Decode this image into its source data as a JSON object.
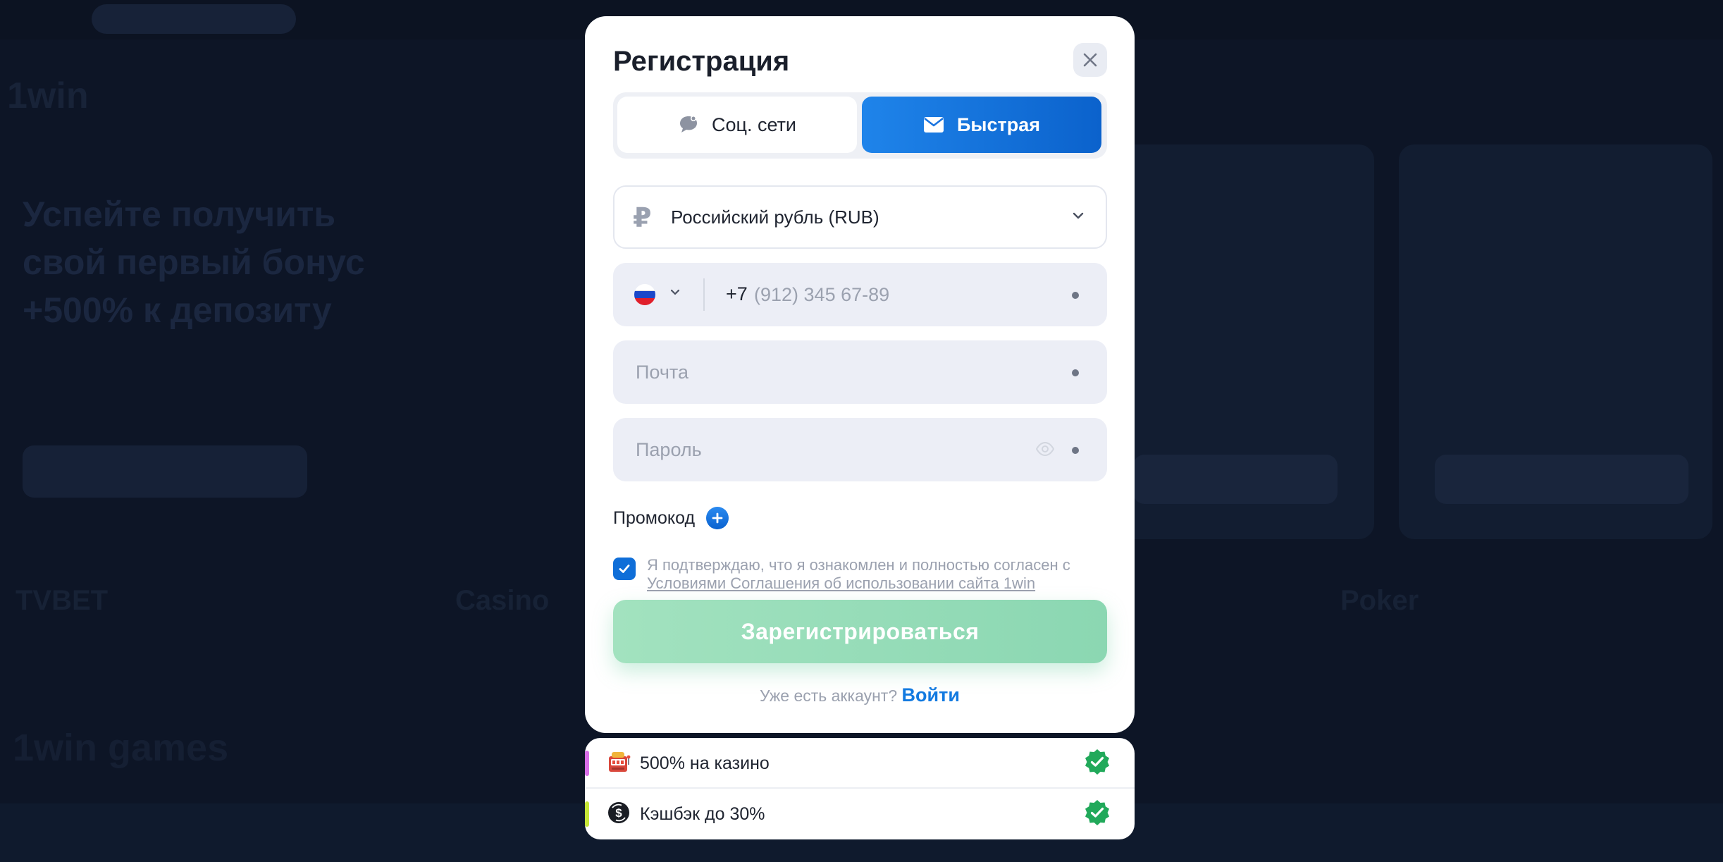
{
  "modal": {
    "title": "Регистрация",
    "tabs": [
      {
        "label": "Соц. сети",
        "icon": "chat-bubble-icon",
        "active": false
      },
      {
        "label": "Быстрая",
        "icon": "envelope-icon",
        "active": true
      }
    ],
    "currency": {
      "symbol": "₽",
      "value": "Российский рубль (RUB)"
    },
    "phone": {
      "country_code": "+7",
      "placeholder": "(912) 345 67-89",
      "flag": "ru"
    },
    "email": {
      "placeholder": "Почта"
    },
    "password": {
      "placeholder": "Пароль"
    },
    "promo_label": "Промокод",
    "agreement": {
      "checked": true,
      "text": "Я подтверждаю, что я ознакомлен и полностью согласен с",
      "link": "Условиями Соглашения об использовании сайта 1win"
    },
    "submit_label": "Зарегистрироваться",
    "login_question": "Уже есть аккаунт?",
    "login_link": "Войти"
  },
  "bonuses": [
    {
      "text": "500% на казино",
      "stripe_color": "#d86ee8"
    },
    {
      "text": "Кэшбэк до 30%",
      "stripe_color": "#c6e637"
    }
  ],
  "background": {
    "logo": "1win",
    "hero_text": "Успейте получить свой первый бонус +500% к депозиту",
    "categories": [
      "TVBET",
      "Casino",
      "Poker"
    ],
    "section_title": "1win games"
  },
  "colors": {
    "primary": "#0f6ed8",
    "submit": "#8bd7b2",
    "backdrop": "#0d1526"
  }
}
